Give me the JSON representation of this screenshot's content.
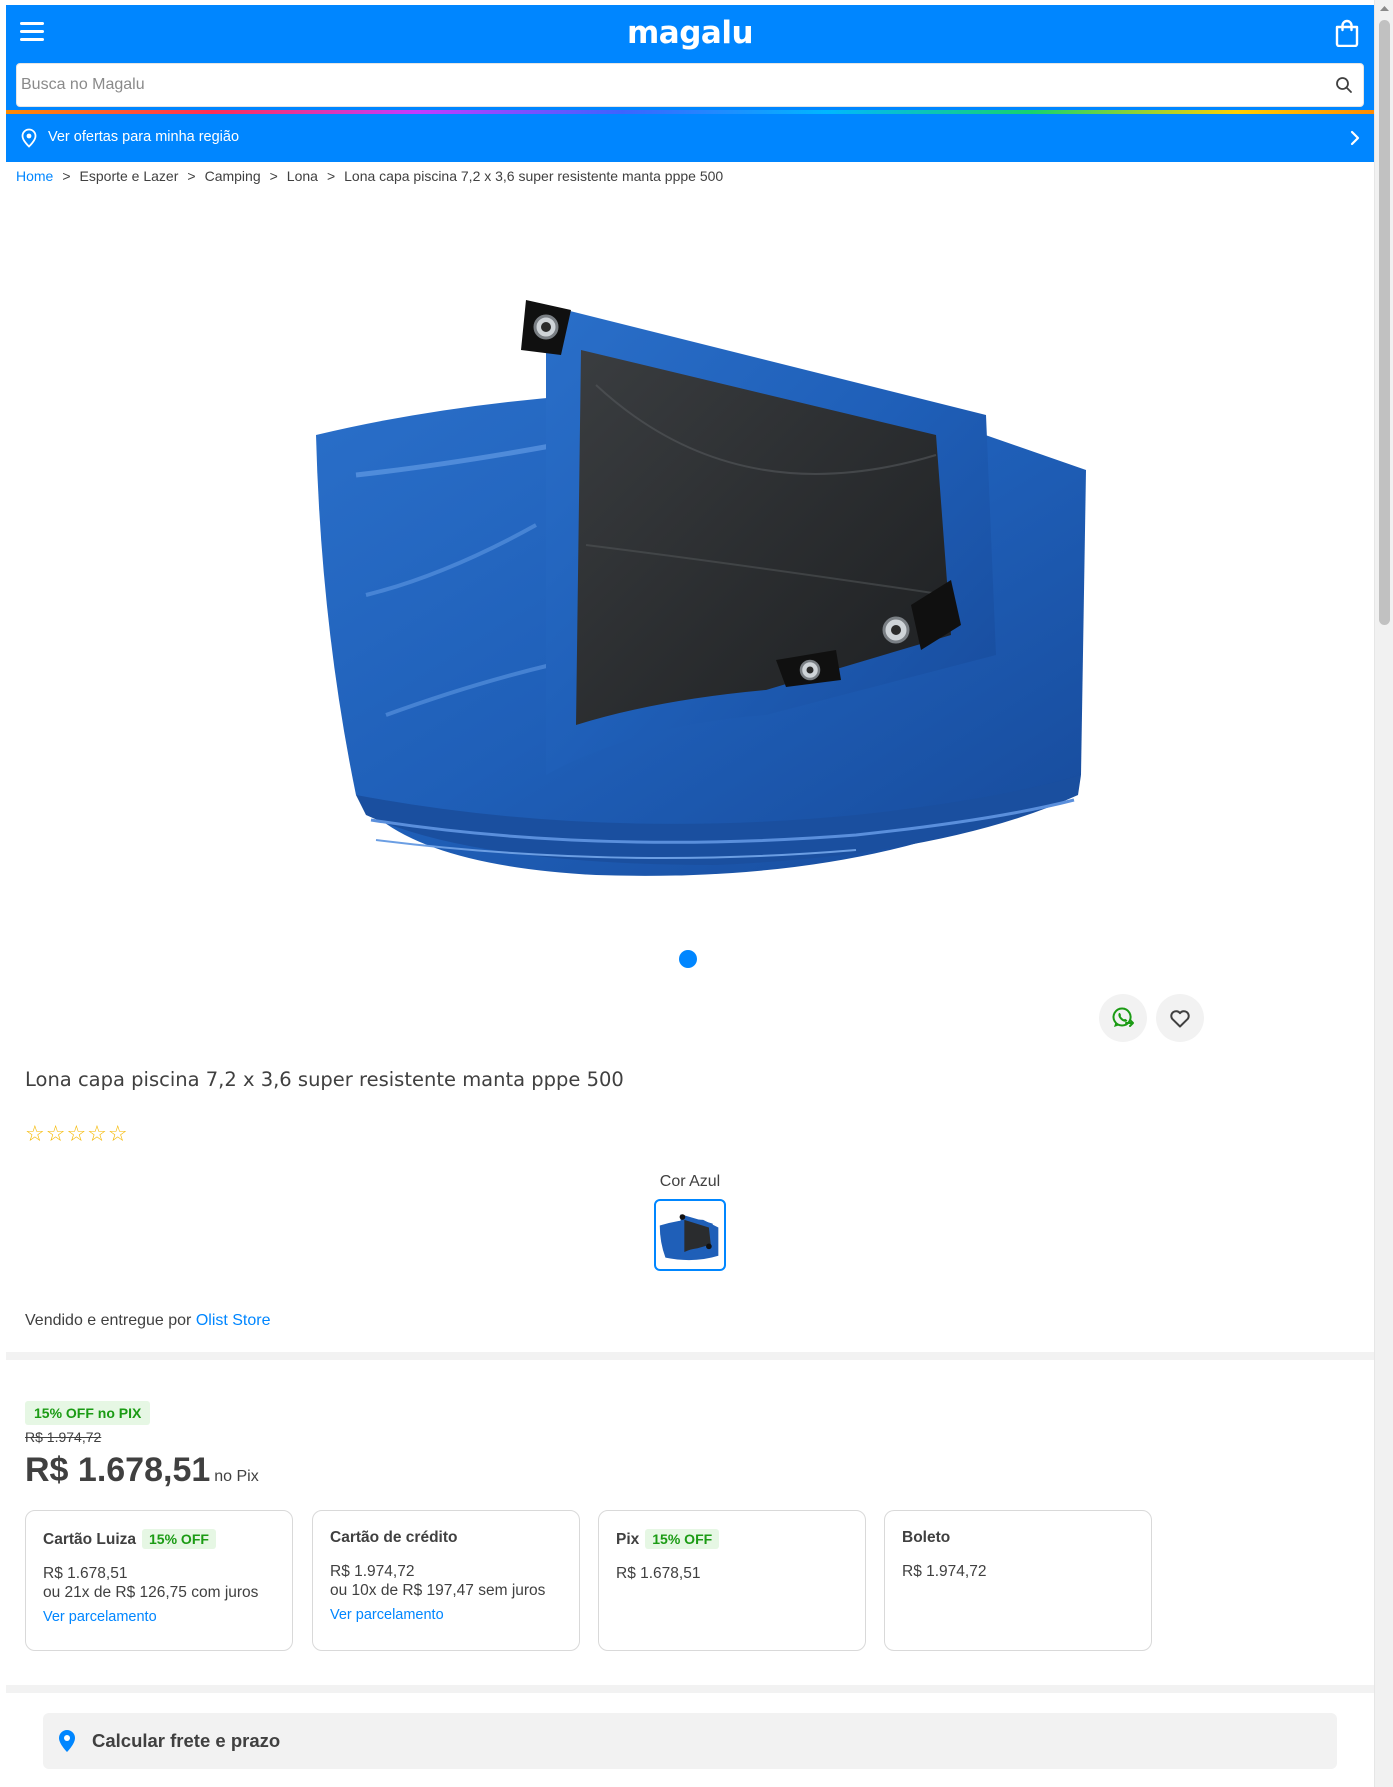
{
  "header": {
    "logo": "magalu",
    "search_placeholder": "Busca no Magalu",
    "region_link": "Ver ofertas para minha região",
    "brand_color": "#0086ff"
  },
  "breadcrumb": {
    "items": [
      "Home",
      "Esporte e Lazer",
      "Camping",
      "Lona",
      "Lona capa piscina 7,2 x 3,6 super resistente manta pppe 500"
    ],
    "separator": ">"
  },
  "gallery": {
    "image_alt": "Lona azul dobrada",
    "current_slide": 1,
    "slide_count": 1
  },
  "product": {
    "title": "Lona capa piscina 7,2 x 3,6 super resistente manta pppe 500",
    "rating_stars": "☆☆☆☆☆",
    "rating_value": 0,
    "color_label": "Cor Azul",
    "seller_prefix": "Vendido e entregue por",
    "seller_name": "Olist Store"
  },
  "pricing": {
    "pix_badge": "15% OFF no PIX",
    "old_price": "R$ 1.974,72",
    "price": "R$ 1.678,51",
    "price_suffix": "no Pix",
    "discount_color": "#1b9b14"
  },
  "payment_options": [
    {
      "title": "Cartão Luiza",
      "badge": "15% OFF",
      "line1": "R$ 1.678,51",
      "line2": "ou 21x de R$ 126,75 com juros",
      "link": "Ver parcelamento"
    },
    {
      "title": "Cartão de crédito",
      "badge": "",
      "line1": "R$ 1.974,72",
      "line2": "ou 10x de R$ 197,47 sem juros",
      "link": "Ver parcelamento"
    },
    {
      "title": "Pix",
      "badge": "15% OFF",
      "line1": "R$ 1.678,51",
      "line2": "",
      "link": ""
    },
    {
      "title": "Boleto",
      "badge": "",
      "line1": "R$ 1.974,72",
      "line2": "",
      "link": ""
    }
  ],
  "shipping": {
    "label": "Calcular frete e prazo"
  },
  "icons": [
    "menu-icon",
    "shopping-bag-icon",
    "search-icon",
    "location-pin-icon",
    "chevron-right-icon",
    "whatsapp-share-icon",
    "heart-icon",
    "star-icon"
  ]
}
